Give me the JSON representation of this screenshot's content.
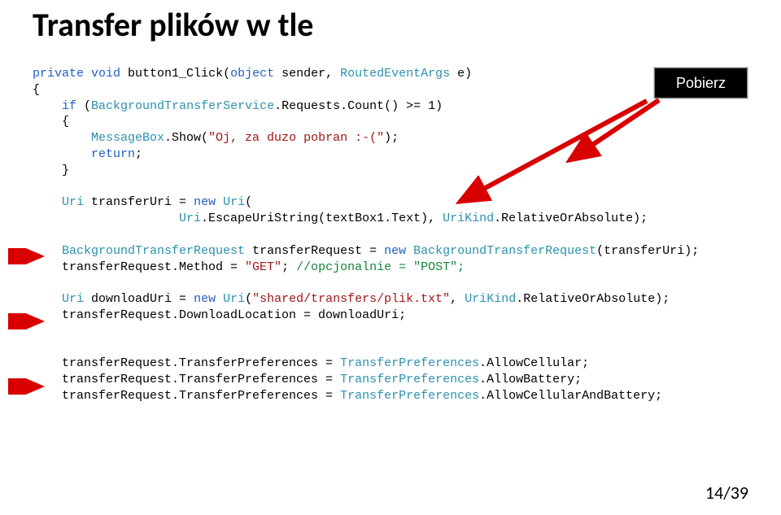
{
  "title": "Transfer plików w tle",
  "button_label": "Pobierz",
  "page_number": "14/39",
  "code": {
    "line1a": "private",
    "line1b": "void",
    "line1c": " button1_Click(",
    "line1d": "object",
    "line1e": " sender, ",
    "line1f": "RoutedEventArgs",
    "line1g": " e)",
    "line2": "{",
    "line3a": "    ",
    "line3b": "if",
    "line3c": " (",
    "line3d": "BackgroundTransferService",
    "line3e": ".Requests.Count() >= 1)",
    "line4": "    {",
    "line5a": "        ",
    "line5b": "MessageBox",
    "line5c": ".Show(",
    "line5d": "\"Oj, za duzo pobran :-(\"",
    "line5e": ");",
    "line6a": "        ",
    "line6b": "return",
    "line6c": ";",
    "line7": "    }",
    "line9a": "    ",
    "line9b": "Uri",
    "line9c": " transferUri = ",
    "line9d": "new",
    "line9e": " ",
    "line9f": "Uri",
    "line9g": "(",
    "line10a": "                    ",
    "line10b": "Uri",
    "line10c": ".EscapeUriString(textBox1.Text), ",
    "line10d": "UriKind",
    "line10e": ".RelativeOrAbsolute);",
    "line12a": "    ",
    "line12b": "BackgroundTransferRequest",
    "line12c": " transferRequest = ",
    "line12d": "new",
    "line12e": " ",
    "line12f": "BackgroundTransferRequest",
    "line12g": "(transferUri);",
    "line13a": "    transferRequest.Method = ",
    "line13b": "\"GET\"",
    "line13c": "; ",
    "line13d": "//opcjonalnie = \"POST\";",
    "line15a": "    ",
    "line15b": "Uri",
    "line15c": " downloadUri = ",
    "line15d": "new",
    "line15e": " ",
    "line15f": "Uri",
    "line15g": "(",
    "line15h": "\"shared/transfers/plik.txt\"",
    "line15i": ", ",
    "line15j": "UriKind",
    "line15k": ".RelativeOrAbsolute);",
    "line16": "    transferRequest.DownloadLocation = downloadUri;",
    "line19a": "    transferRequest.TransferPreferences = ",
    "line19b": "TransferPreferences",
    "line19c": ".AllowCellular;",
    "line20a": "    transferRequest.TransferPreferences = ",
    "line20b": "TransferPreferences",
    "line20c": ".AllowBattery;",
    "line21a": "    transferRequest.TransferPreferences = ",
    "line21b": "TransferPreferences",
    "line21c": ".AllowCellularAndBattery;"
  }
}
